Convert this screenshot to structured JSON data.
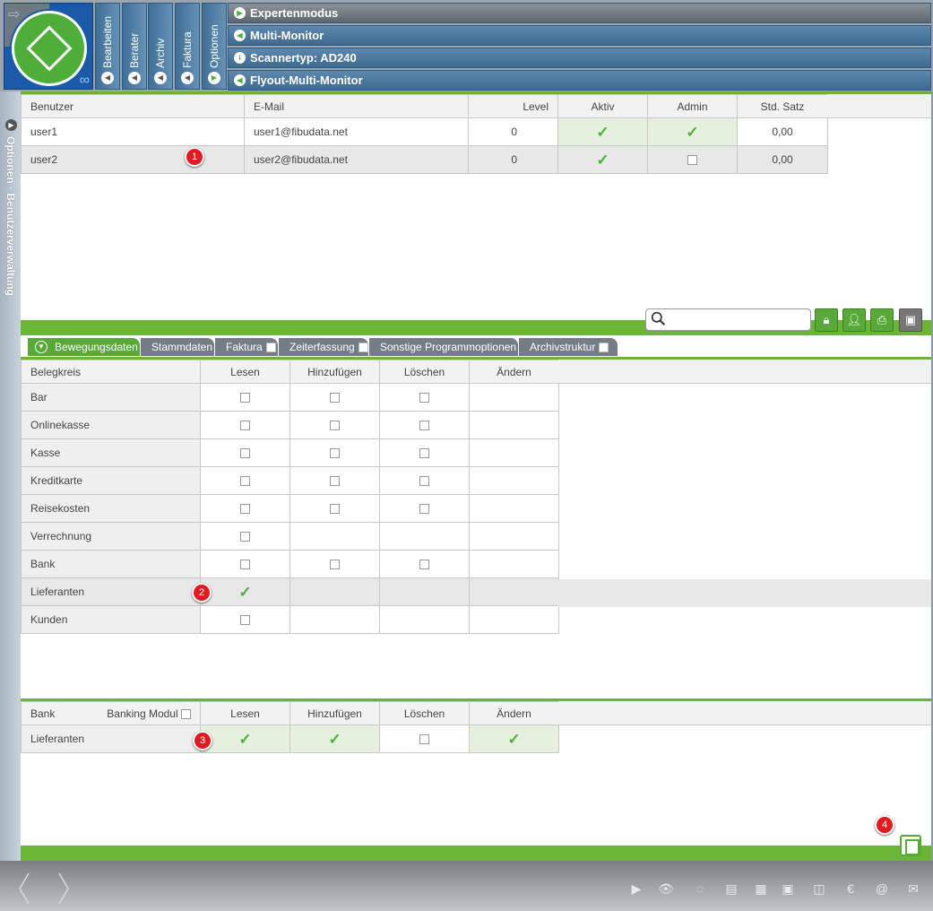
{
  "sidebar_tabs": [
    {
      "label": "Bearbeiten"
    },
    {
      "label": "Berater"
    },
    {
      "label": "Archiv"
    },
    {
      "label": "Faktura"
    },
    {
      "label": "Optionen"
    }
  ],
  "menu": [
    {
      "label": "Expertenmodus"
    },
    {
      "label": "Multi-Monitor"
    },
    {
      "label": "Scannertyp: AD240"
    },
    {
      "label": "Flyout-Multi-Monitor"
    }
  ],
  "side_strip": {
    "label": "Optionen · Benutzerverwaltung"
  },
  "users": {
    "headers": [
      "Benutzer",
      "E-Mail",
      "Level",
      "Aktiv",
      "Admin",
      "Std. Satz"
    ],
    "rows": [
      {
        "name": "user1",
        "email": "user1@fibudata.net",
        "level": "0",
        "aktiv": true,
        "admin": true,
        "satz": "0,00"
      },
      {
        "name": "user2",
        "email": "user2@fibudata.net",
        "level": "0",
        "aktiv": true,
        "admin": false,
        "satz": "0,00"
      }
    ]
  },
  "search": {
    "placeholder": ""
  },
  "tabs": [
    {
      "label": "Bewegungsdaten"
    },
    {
      "label": "Stammdaten"
    },
    {
      "label": "Faktura"
    },
    {
      "label": "Zeiterfassung"
    },
    {
      "label": "Sonstige Programmoptionen"
    },
    {
      "label": "Archivstruktur"
    }
  ],
  "belegkreis": {
    "headers": [
      "Belegkreis",
      "Lesen",
      "Hinzufügen",
      "Löschen",
      "Ändern"
    ],
    "rows": [
      {
        "name": "Bar",
        "lesen": false,
        "hinz": false,
        "loesch": false
      },
      {
        "name": "Onlinekasse",
        "lesen": false,
        "hinz": false,
        "loesch": false
      },
      {
        "name": "Kasse",
        "lesen": false,
        "hinz": false,
        "loesch": false
      },
      {
        "name": "Kreditkarte",
        "lesen": false,
        "hinz": false,
        "loesch": false
      },
      {
        "name": "Reisekosten",
        "lesen": false,
        "hinz": false,
        "loesch": false
      },
      {
        "name": "Verrechnung",
        "lesen": false
      },
      {
        "name": "Bank",
        "lesen": false,
        "hinz": false,
        "loesch": false
      },
      {
        "name": "Lieferanten",
        "lesen": true
      },
      {
        "name": "Kunden",
        "lesen": false
      }
    ]
  },
  "bank": {
    "headers": [
      "Bank",
      "Banking Modul",
      "Lesen",
      "Hinzufügen",
      "Löschen",
      "Ändern"
    ],
    "rows": [
      {
        "name": "Lieferanten",
        "lesen": true,
        "hinz": true,
        "loesch": false,
        "aendern": true
      }
    ]
  },
  "badges": [
    "1",
    "2",
    "3",
    "4"
  ],
  "colors": {
    "accent": "#58a83a",
    "menu": "#3e6b91",
    "badge": "#e01b22"
  }
}
